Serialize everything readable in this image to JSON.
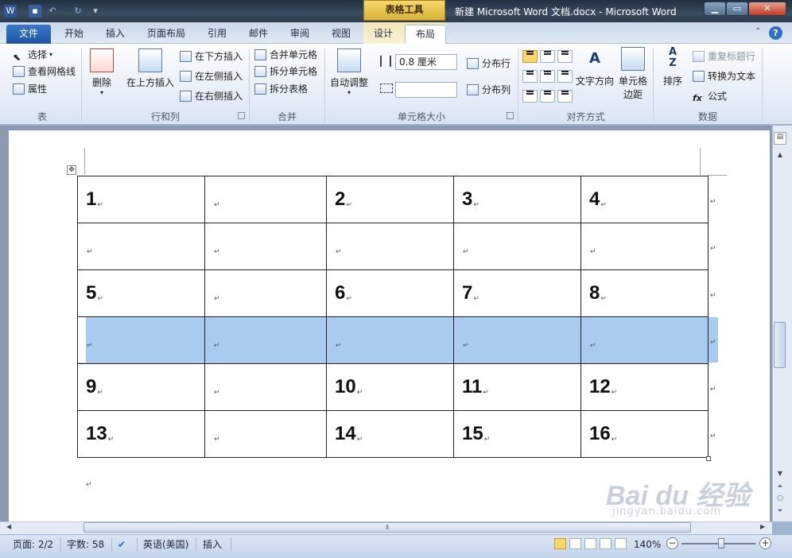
{
  "titlebar": {
    "contextual_tab_group": "表格工具",
    "document_title": "新建 Microsoft Word 文档.docx  -  Microsoft Word",
    "qat": [
      "save-icon",
      "undo-icon",
      "redo-icon",
      "customize-qat-icon"
    ]
  },
  "tabs": {
    "file": "文件",
    "home": "开始",
    "insert": "插入",
    "page_layout": "页面布局",
    "references": "引用",
    "mailings": "邮件",
    "review": "审阅",
    "view": "视图",
    "design": "设计",
    "layout": "布局"
  },
  "ribbon": {
    "table_group": {
      "label": "表",
      "select": "选择",
      "view_gridlines": "查看网格线",
      "properties": "属性"
    },
    "rows_cols_group": {
      "label": "行和列",
      "delete": "删除",
      "insert_above": "在上方插入",
      "insert_below": "在下方插入",
      "insert_left": "在左侧插入",
      "insert_right": "在右侧插入"
    },
    "merge_group": {
      "label": "合并",
      "merge_cells": "合并单元格",
      "split_cells": "拆分单元格",
      "split_table": "拆分表格"
    },
    "cell_size_group": {
      "label": "单元格大小",
      "autofit": "自动调整",
      "height_value": "0.8 厘米",
      "width_value": "",
      "distribute_rows": "分布行",
      "distribute_cols": "分布列"
    },
    "alignment_group": {
      "label": "对齐方式",
      "text_direction": "文字方向",
      "cell_margins_line1": "单元格",
      "cell_margins_line2": "边距"
    },
    "data_group": {
      "label": "数据",
      "sort": "排序",
      "repeat_header": "重复标题行",
      "convert_to_text": "转换为文本",
      "formula": "公式"
    }
  },
  "table": {
    "rows": [
      [
        "1",
        "",
        "2",
        "3",
        "4"
      ],
      [
        "",
        "",
        "",
        "",
        ""
      ],
      [
        "5",
        "",
        "6",
        "7",
        "8"
      ],
      [
        "",
        "",
        "",
        "",
        ""
      ],
      [
        "9",
        "",
        "10",
        "11",
        "12"
      ],
      [
        "13",
        "",
        "14",
        "15",
        "16"
      ]
    ],
    "selected_row": 3,
    "cell_mark": "↵"
  },
  "statusbar": {
    "page": "页面: 2/2",
    "words": "字数: 58",
    "language": "英语(美国)",
    "mode": "插入",
    "zoom": "140%",
    "zoom_minus": "−",
    "zoom_plus": "+"
  },
  "watermark": {
    "brand": "Bai du 经验",
    "url": "jingyan.baidu.com"
  },
  "colors": {
    "selection": "#a9cbef",
    "file_tab": "#2a62b0",
    "contextual": "#f2d266"
  }
}
